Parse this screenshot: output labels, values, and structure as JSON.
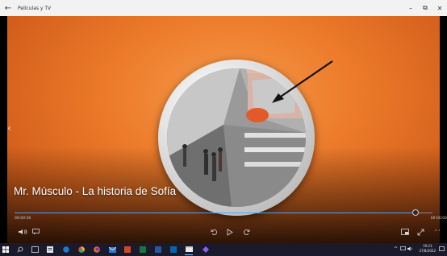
{
  "window": {
    "title": "Películas y TV",
    "back_icon": "arrow-left-icon",
    "minimize_label": "–",
    "maximize_label": "⧉",
    "close_label": "✕"
  },
  "video": {
    "caption": "Mr. Músculo - La historia de Sofía",
    "background_color": "#ec7a2a"
  },
  "playback": {
    "elapsed": "00:00:56",
    "remaining": "00:00:04",
    "progress": 0.96
  },
  "controls": {
    "volume_icon": "speaker-icon",
    "subtitles_icon": "subtitles-icon",
    "rewind_icon": "rewind-10-icon",
    "play_icon": "play-icon",
    "forward_icon": "forward-30-icon",
    "miniview_icon": "mini-view-icon",
    "fullscreen_icon": "fullscreen-icon",
    "more_icon": "more-icon"
  },
  "taskbar": {
    "time": "19:23",
    "date": "27/8/2022"
  }
}
